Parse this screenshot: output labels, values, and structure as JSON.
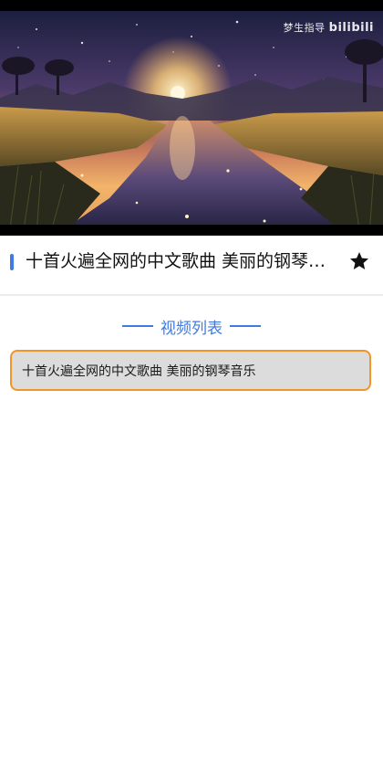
{
  "video": {
    "watermark_prefix": "梦生指导",
    "watermark_brand": "bilibili"
  },
  "header": {
    "title": "十首火遍全网的中文歌曲 美丽的钢琴音乐",
    "favorite_icon": "star-icon",
    "accent_color": "#3f7be0"
  },
  "section": {
    "title": "视频列表"
  },
  "playlist": {
    "items": [
      {
        "label": "十首火遍全网的中文歌曲 美丽的钢琴音乐",
        "active": true
      }
    ],
    "active_border_color": "#f39427"
  }
}
